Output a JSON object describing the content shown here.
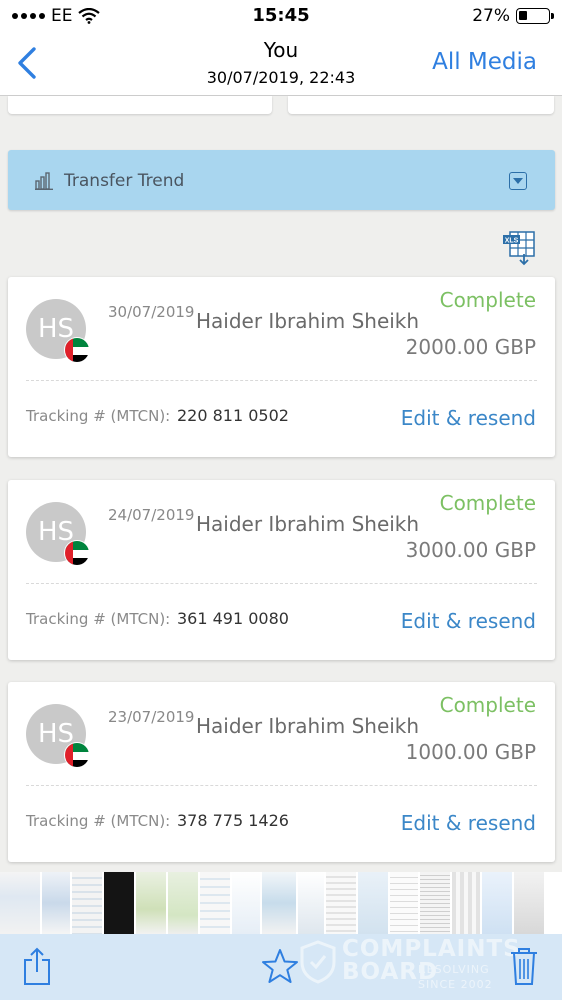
{
  "status_bar": {
    "carrier": "EE",
    "time": "15:45",
    "battery": "27%",
    "battery_level": 0.27
  },
  "nav": {
    "title": "You",
    "subtitle": "30/07/2019, 22:43",
    "right_label": "All Media",
    "back_icon": "chevron-left-icon"
  },
  "trend": {
    "label": "Transfer Trend",
    "icon": "bar-chart-icon",
    "toggle_icon": "dropdown-icon"
  },
  "export_icon": "xls-download-icon",
  "transactions": [
    {
      "initials": "HS",
      "date": "30/07/2019",
      "name": "Haider Ibrahim Sheikh",
      "status": "Complete",
      "amount": "2000.00 GBP",
      "tracking_label": "Tracking # (MTCN):",
      "tracking_number": "220 811 0502",
      "action": "Edit & resend"
    },
    {
      "initials": "HS",
      "date": "24/07/2019",
      "name": "Haider Ibrahim Sheikh",
      "status": "Complete",
      "amount": "3000.00 GBP",
      "tracking_label": "Tracking # (MTCN):",
      "tracking_number": "361 491 0080",
      "action": "Edit & resend"
    },
    {
      "initials": "HS",
      "date": "23/07/2019",
      "name": "Haider Ibrahim Sheikh",
      "status": "Complete",
      "amount": "1000.00 GBP",
      "tracking_label": "Tracking # (MTCN):",
      "tracking_number": "378 775 1426",
      "action": "Edit & resend"
    }
  ],
  "toolbar": {
    "share_icon": "share-icon",
    "favorite_icon": "star-icon",
    "delete_icon": "trash-icon"
  },
  "watermark": {
    "line1": "COMPLAINTS",
    "line2": "BOARD",
    "line3": "RESOLVING",
    "line4": "SINCE 2002"
  },
  "colors": {
    "accent": "#2f7fe0",
    "status_complete": "#7cc063",
    "link": "#3b87c8",
    "trend_bg": "#a9d6ef",
    "toolbar_bg": "#d6e7f6"
  }
}
